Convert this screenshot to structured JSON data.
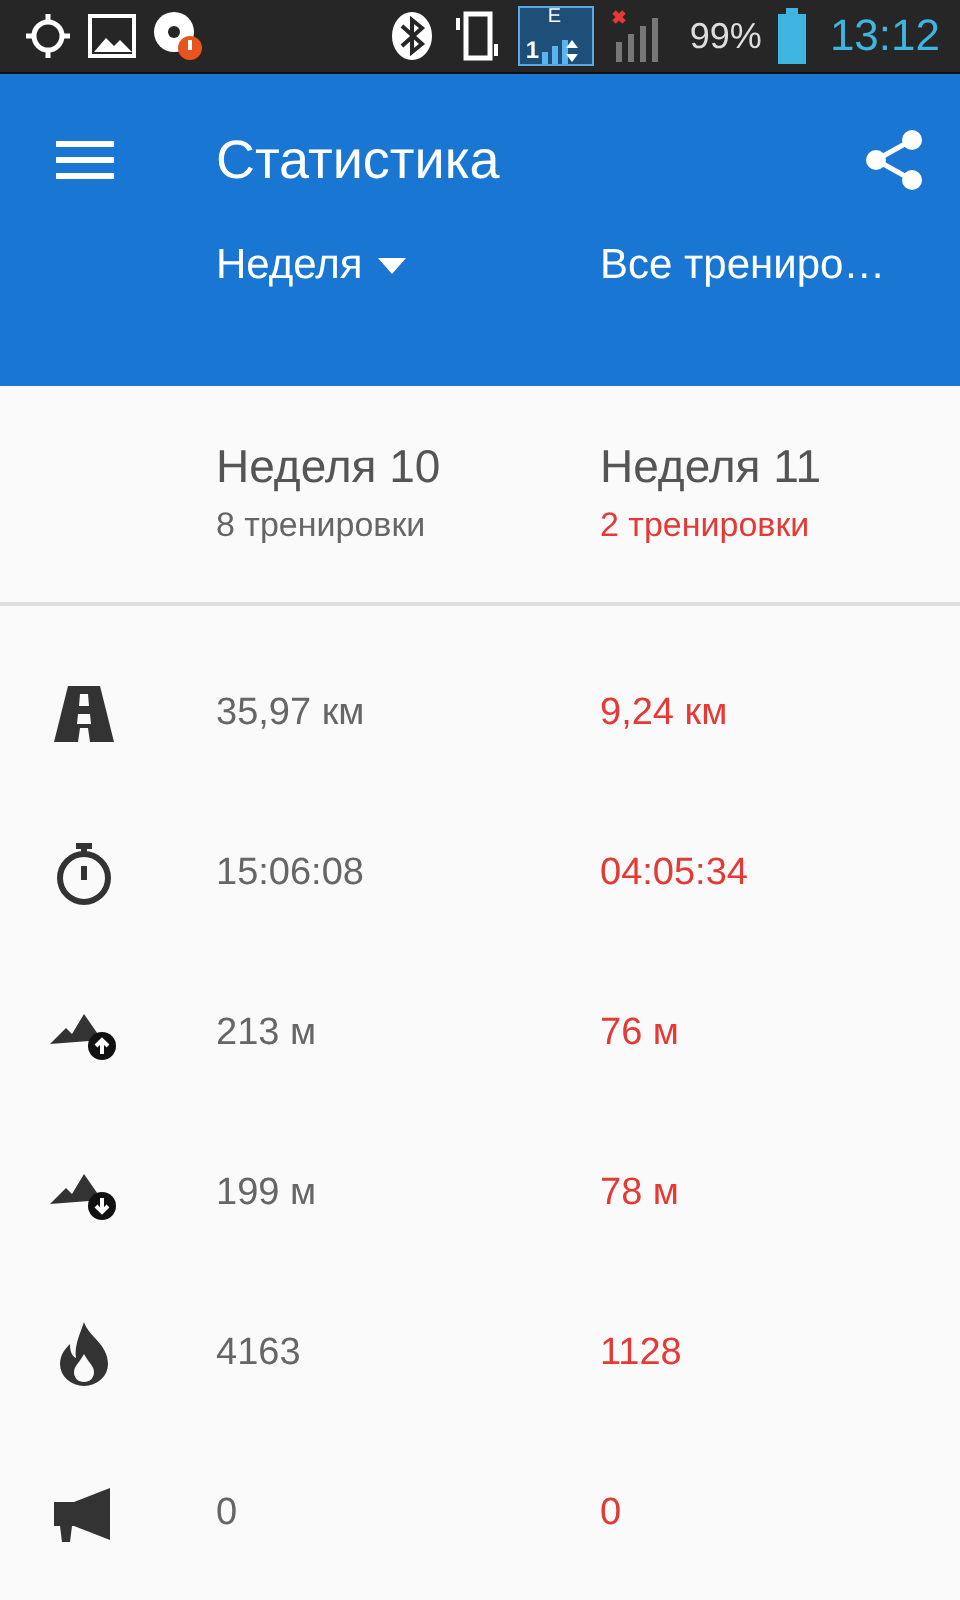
{
  "status_bar": {
    "network_label": "E",
    "sim_label": "1",
    "battery": "99%",
    "time": "13:12"
  },
  "app_bar": {
    "title": "Статистика",
    "filters": [
      {
        "label": "Неделя",
        "kind": "dropdown"
      },
      {
        "label": "Все трениро…",
        "kind": "plain"
      }
    ]
  },
  "columns": [
    {
      "title": "Неделя 10",
      "subtitle": "8 тренировки",
      "highlighted": false
    },
    {
      "title": "Неделя 11",
      "subtitle": "2 тренировки",
      "highlighted": true
    }
  ],
  "rows": [
    {
      "kind": "distance",
      "values": [
        "35,97 км",
        "9,24 км"
      ]
    },
    {
      "kind": "duration",
      "values": [
        "15:06:08",
        "04:05:34"
      ]
    },
    {
      "kind": "ascent",
      "values": [
        "213 м",
        "76 м"
      ]
    },
    {
      "kind": "descent",
      "values": [
        "199 м",
        "78 м"
      ]
    },
    {
      "kind": "calories",
      "values": [
        "4163",
        "1128"
      ]
    },
    {
      "kind": "feedback",
      "values": [
        "0",
        "0"
      ]
    }
  ]
}
